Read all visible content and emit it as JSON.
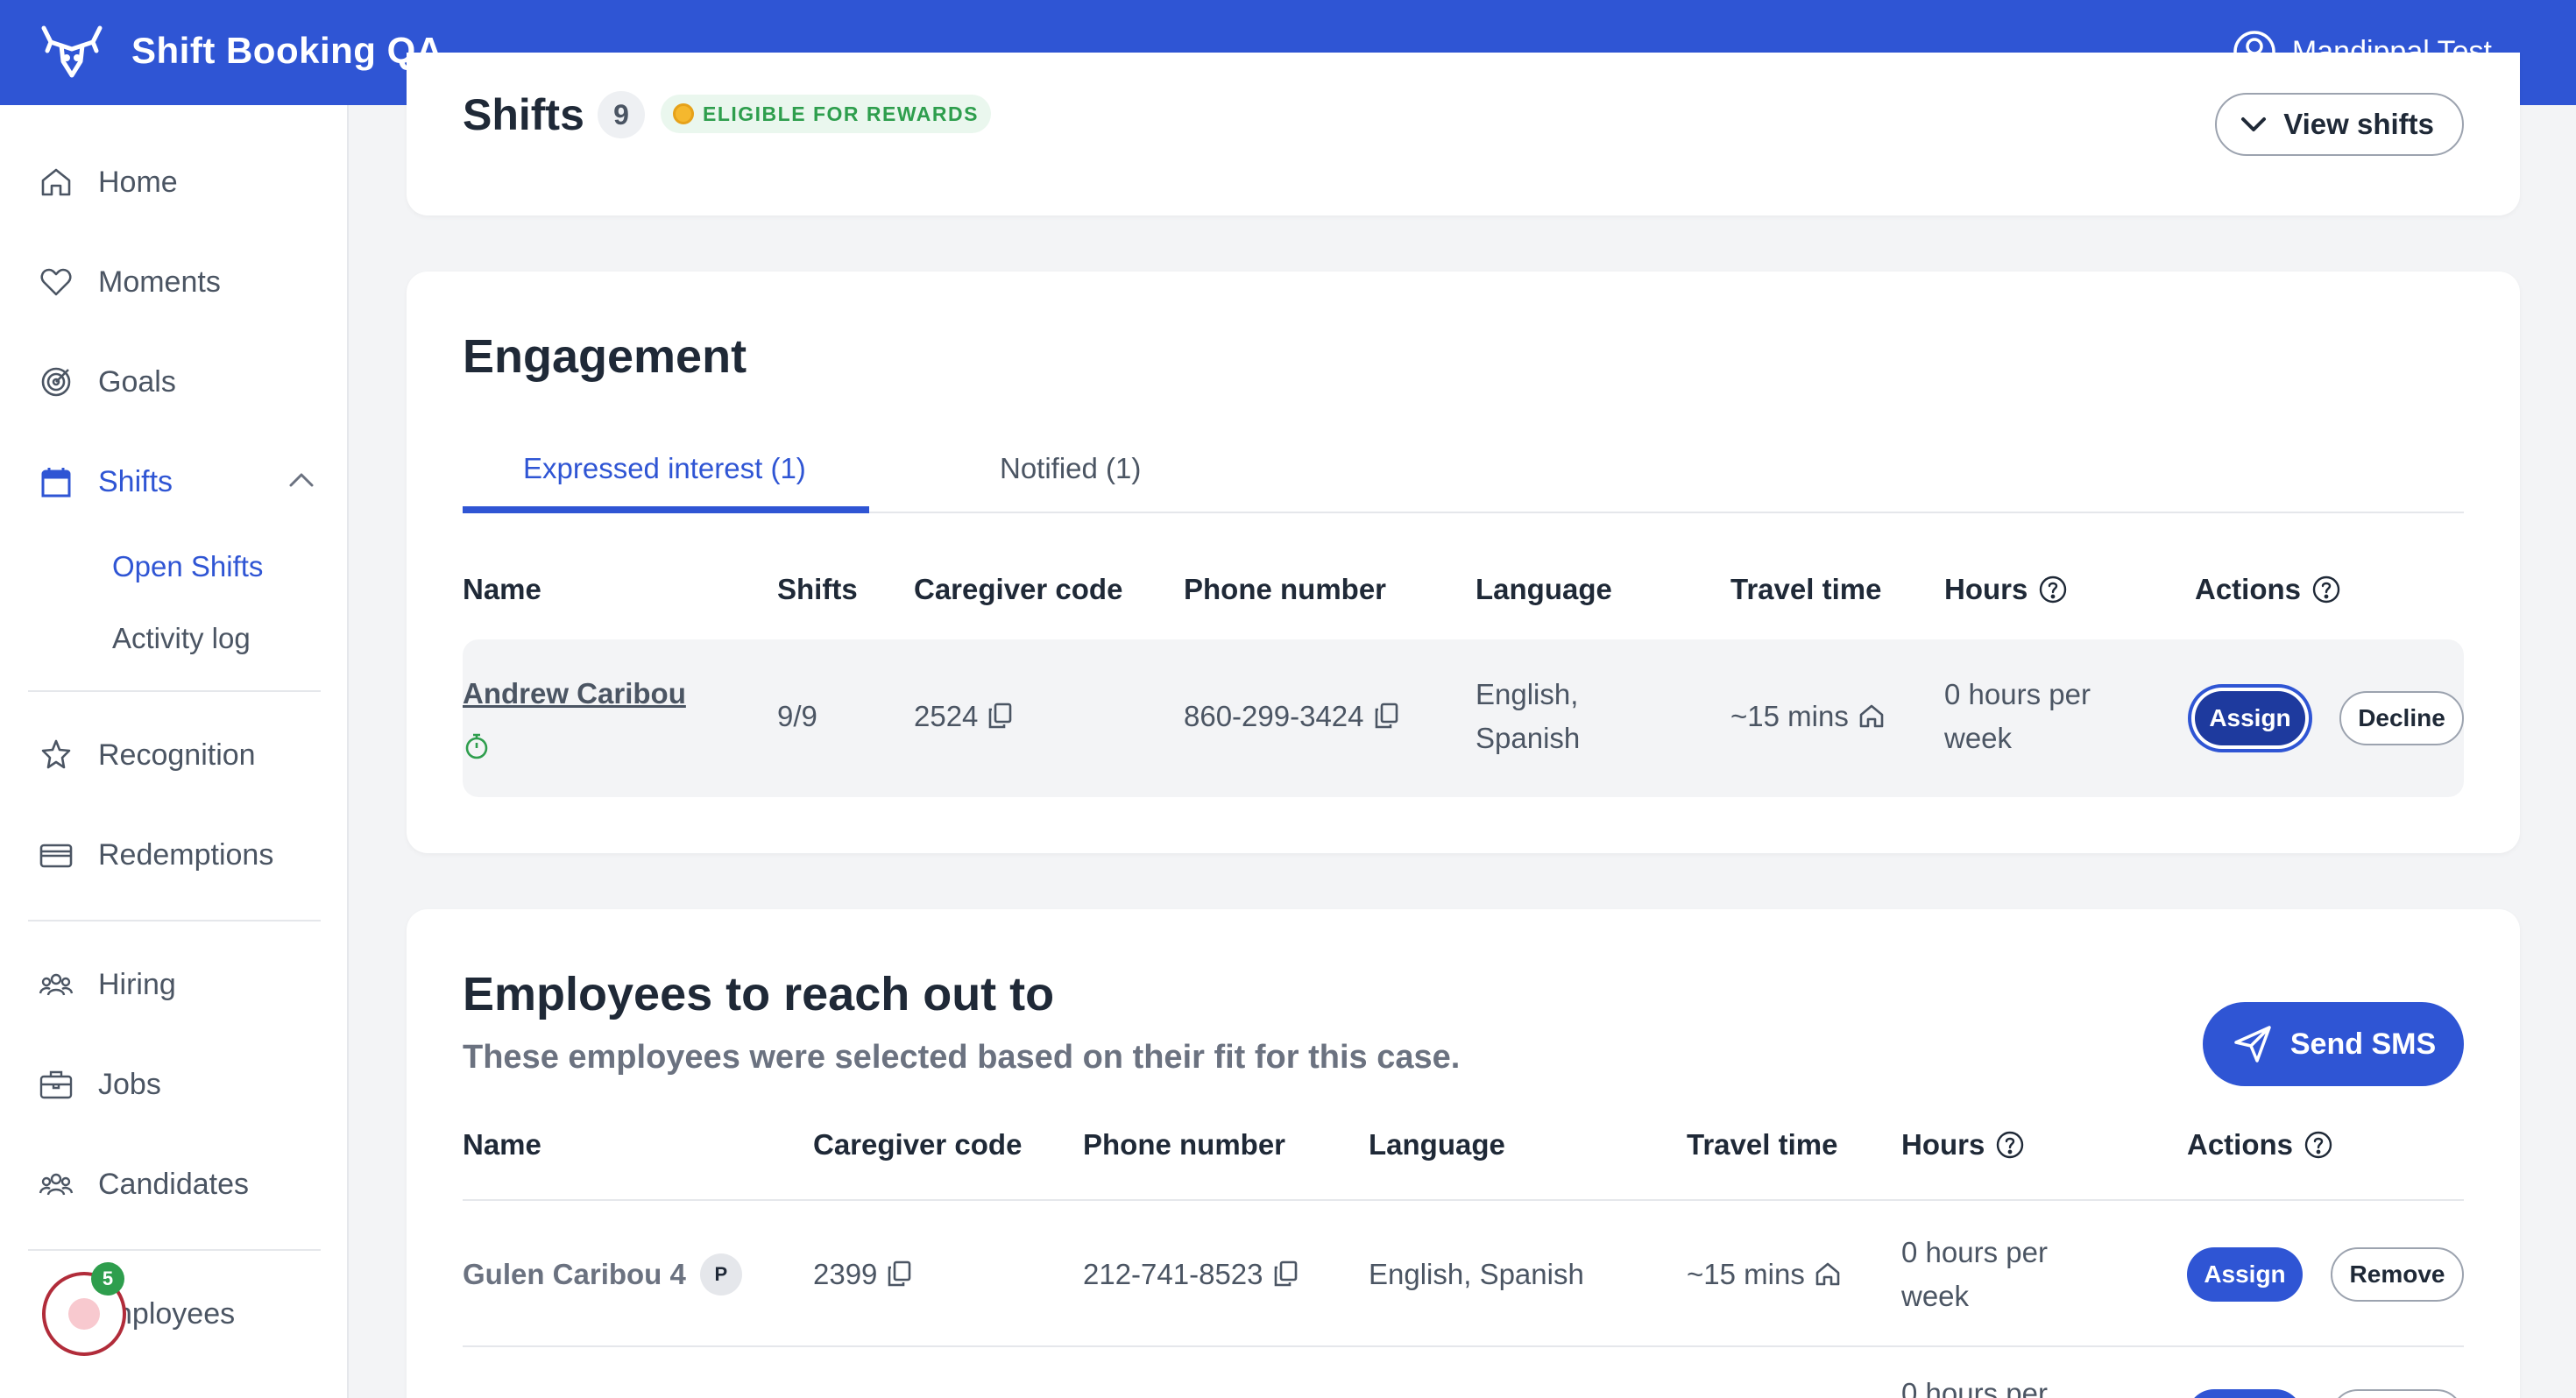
{
  "app": {
    "title": "Shift Booking QA",
    "user_name": "Mandippal Test"
  },
  "sidebar": {
    "items": [
      {
        "label": "Home",
        "icon": "home-icon"
      },
      {
        "label": "Moments",
        "icon": "heart-icon"
      },
      {
        "label": "Goals",
        "icon": "target-icon"
      },
      {
        "label": "Shifts",
        "icon": "calendar-icon"
      },
      {
        "label": "Recognition",
        "icon": "star-icon"
      },
      {
        "label": "Redemptions",
        "icon": "credit-card-icon"
      },
      {
        "label": "Hiring",
        "icon": "people-icon"
      },
      {
        "label": "Jobs",
        "icon": "briefcase-icon"
      },
      {
        "label": "Candidates",
        "icon": "people-icon"
      },
      {
        "label": "nployees",
        "icon": "people-icon"
      }
    ],
    "shifts_sub": [
      {
        "label": "Open Shifts"
      },
      {
        "label": "Activity log"
      }
    ],
    "widget_badge": "5"
  },
  "shifts_card": {
    "title": "Shifts",
    "count": "9",
    "rewards_label": "ELIGIBLE FOR REWARDS",
    "view_button": "View shifts"
  },
  "engagement": {
    "title": "Engagement",
    "tabs": [
      {
        "label": "Expressed interest (1)"
      },
      {
        "label": "Notified (1)"
      }
    ],
    "columns": [
      "Name",
      "Shifts",
      "Caregiver code",
      "Phone number",
      "Language",
      "Travel time",
      "Hours",
      "Actions"
    ],
    "rows": [
      {
        "name": "Andrew Caribou",
        "shifts": "9/9",
        "code": "2524",
        "phone": "860-299-3424",
        "language_line1": "English,",
        "language_line2": "Spanish",
        "travel": "~15 mins",
        "hours_line1": "0 hours per",
        "hours_line2": "week",
        "assign": "Assign",
        "decline": "Decline"
      }
    ]
  },
  "reach_out": {
    "title": "Employees to reach out to",
    "subtitle": "These employees were selected based on their fit for this case.",
    "send_sms": "Send SMS",
    "columns": [
      "Name",
      "Caregiver code",
      "Phone number",
      "Language",
      "Travel time",
      "Hours",
      "Actions"
    ],
    "rows": [
      {
        "name": "Gulen Caribou 4",
        "badge": "P",
        "code": "2399",
        "phone": "212-741-8523",
        "language": "English, Spanish",
        "travel": "~15 mins",
        "hours_line1": "0 hours per",
        "hours_line2": "week",
        "assign": "Assign",
        "remove": "Remove"
      },
      {
        "hours_line1": "0 hours per"
      }
    ]
  }
}
